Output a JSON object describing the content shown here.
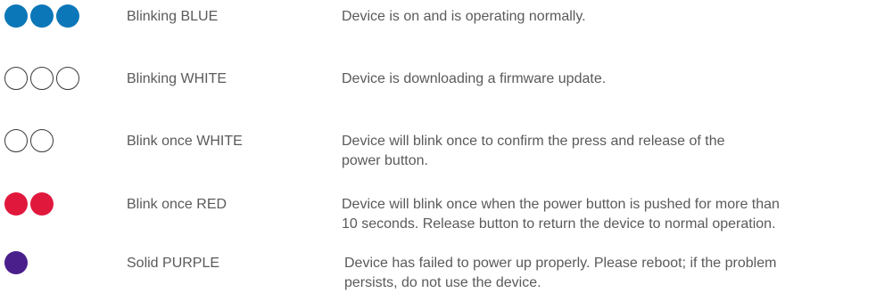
{
  "colors": {
    "blue": "#0b77b8",
    "white": "#ffffff",
    "red": "#e0183c",
    "purple": "#4a1f8c",
    "text": "#5a5a5a"
  },
  "rows": [
    {
      "label": "Blinking BLUE",
      "description_lines": [
        "Device is on and is operating normally."
      ],
      "dot_count": 3,
      "dot_style": "filled",
      "dot_color": "blue"
    },
    {
      "label": "Blinking WHITE",
      "description_lines": [
        "Device is downloading a firmware update."
      ],
      "dot_count": 3,
      "dot_style": "outline",
      "dot_color": "white"
    },
    {
      "label": "Blink once WHITE",
      "description_lines": [
        "Device will blink once to confirm the press and release of the",
        "power button."
      ],
      "dot_count": 2,
      "dot_style": "outline",
      "dot_color": "white"
    },
    {
      "label": "Blink once RED",
      "description_lines": [
        "Device will blink once when the power button is pushed for more than",
        "10 seconds. Release button to return the device to normal operation."
      ],
      "dot_count": 2,
      "dot_style": "filled",
      "dot_color": "red"
    },
    {
      "label": "Solid PURPLE",
      "description_lines": [
        "Device has failed to power up properly. Please reboot; if the problem",
        "persists, do not use the device."
      ],
      "dot_count": 1,
      "dot_style": "filled",
      "dot_color": "purple"
    }
  ]
}
